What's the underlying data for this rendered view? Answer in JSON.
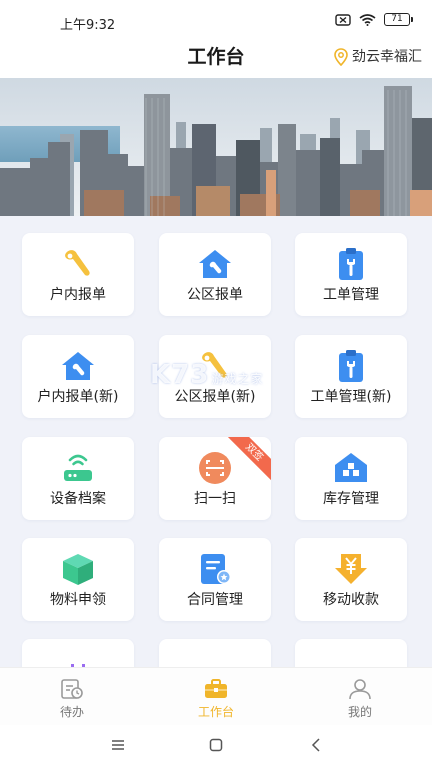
{
  "status": {
    "time": "上午9:32",
    "battery": "71"
  },
  "header": {
    "title": "工作台",
    "location": "劲云幸福汇"
  },
  "grid": {
    "items": [
      {
        "label": "户内报单",
        "icon": "wrench-icon"
      },
      {
        "label": "公区报单",
        "icon": "house-wrench-icon"
      },
      {
        "label": "工单管理",
        "icon": "clipboard-wrench-icon"
      },
      {
        "label": "户内报单(新)",
        "icon": "house-wrench-icon"
      },
      {
        "label": "公区报单(新)",
        "icon": "wrench-icon"
      },
      {
        "label": "工单管理(新)",
        "icon": "clipboard-wrench-icon"
      },
      {
        "label": "设备档案",
        "icon": "router-icon"
      },
      {
        "label": "扫一扫",
        "icon": "scan-icon",
        "badge": "双签"
      },
      {
        "label": "库存管理",
        "icon": "warehouse-icon"
      },
      {
        "label": "物料申领",
        "icon": "box-icon"
      },
      {
        "label": "合同管理",
        "icon": "contract-icon"
      },
      {
        "label": "移动收款",
        "icon": "yen-arrow-icon"
      }
    ]
  },
  "watermark": {
    "brand": "K73",
    "tagline": "游戏之家"
  },
  "tabs": [
    {
      "label": "待办",
      "icon": "todo-icon",
      "active": false
    },
    {
      "label": "工作台",
      "icon": "briefcase-icon",
      "active": true
    },
    {
      "label": "我的",
      "icon": "user-icon",
      "active": false
    }
  ],
  "colors": {
    "accent": "#f0b52a",
    "blue": "#3d8ef0",
    "green": "#3cc78f",
    "grid_bg": "#f0f2f9",
    "orange": "#f08a5d"
  }
}
